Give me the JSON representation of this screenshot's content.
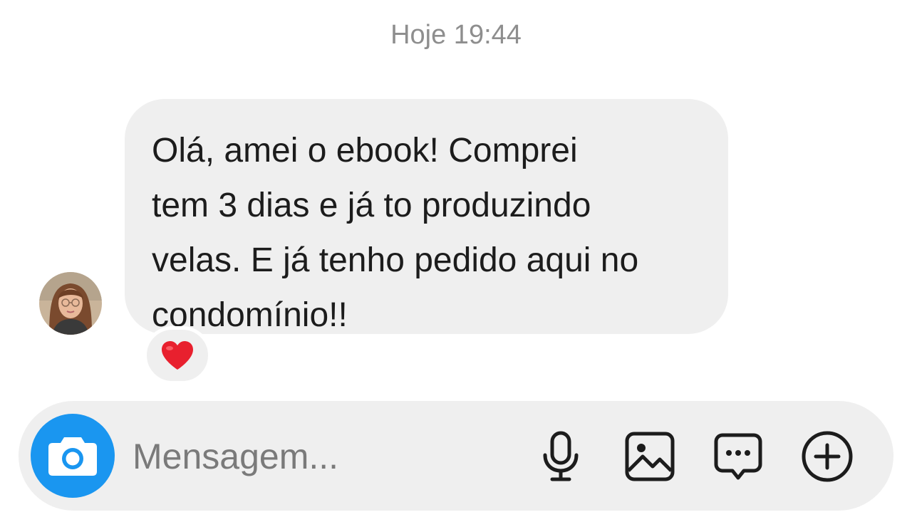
{
  "header": {
    "timestamp": "Hoje 19:44"
  },
  "message": {
    "sender_avatar": "avatar-photo",
    "text": "Olá, amei o ebook! Comprei\ntem 3 dias e já to produzindo\nvelas. E já tenho pedido aqui no\ncondomínio!!",
    "reaction": "heart-emoji"
  },
  "composer": {
    "placeholder": "Mensagem...",
    "value": "",
    "camera_icon": "camera-icon",
    "mic_icon": "microphone-icon",
    "gallery_icon": "image-icon",
    "sticker_icon": "chat-bubble-icon",
    "plus_icon": "plus-circle-icon",
    "accent_color": "#1a96f0"
  },
  "colors": {
    "bubble_bg": "#efefef",
    "timestamp": "#8e8e8e",
    "text": "#1c1c1c",
    "heart": "#e8202e"
  }
}
